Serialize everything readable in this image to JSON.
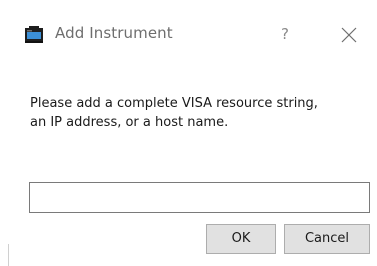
{
  "window": {
    "title": "Add Instrument",
    "icon": "instrument-app-icon",
    "help_label": "?",
    "close_icon": "close-icon"
  },
  "message": {
    "line1": "Please add a complete VISA resource string,",
    "line2": "an IP address, or a host name."
  },
  "input": {
    "value": "",
    "placeholder": ""
  },
  "buttons": {
    "ok": "OK",
    "cancel": "Cancel"
  },
  "colors": {
    "title_text": "#6e6e6e",
    "button_bg": "#e1e1e1",
    "input_border": "#7a7a7a"
  }
}
